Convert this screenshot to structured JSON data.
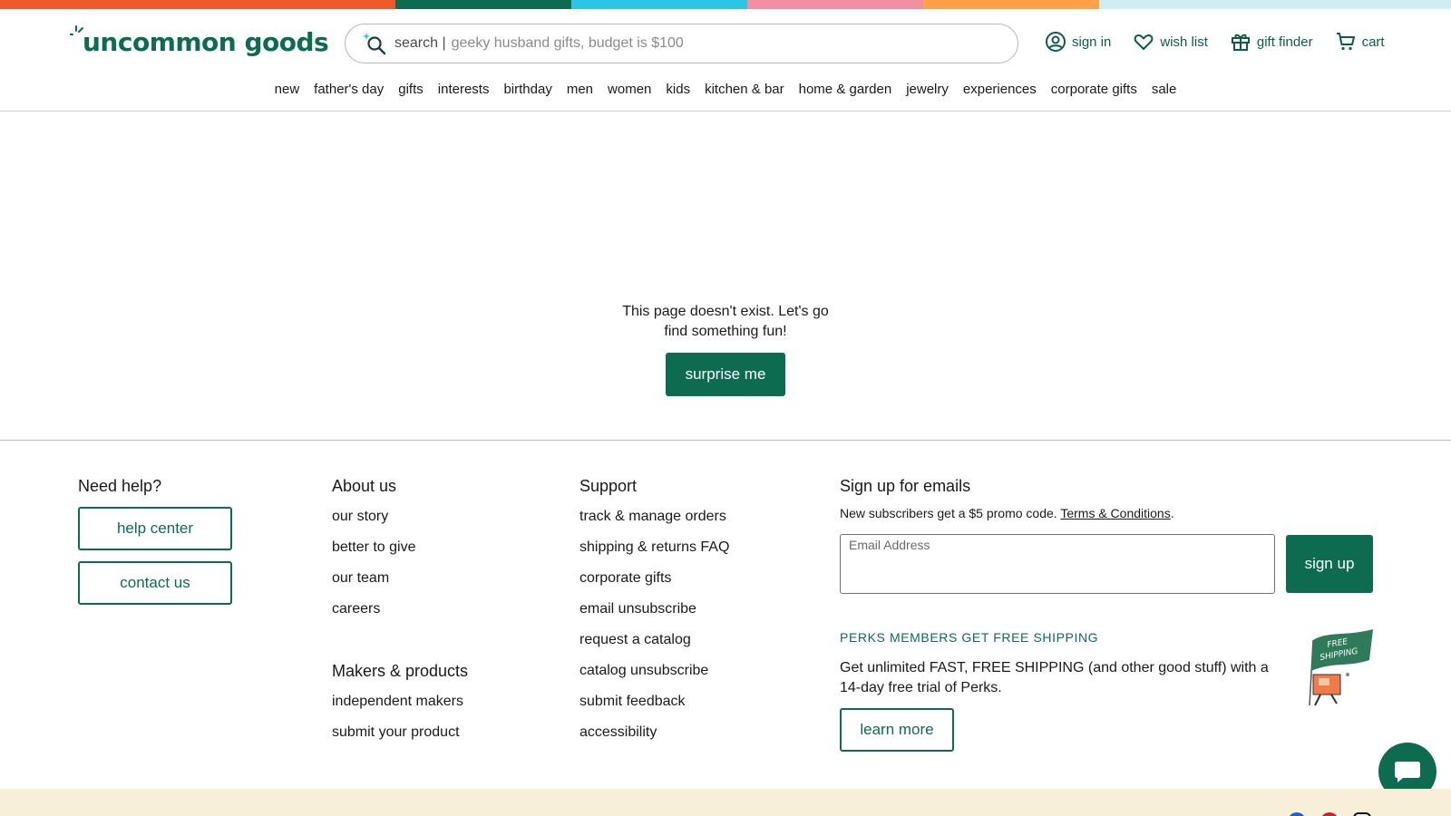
{
  "stripe_colors": [
    "#ef5a2a",
    "#0d6b4f",
    "#2ec4e6",
    "#f28fa0",
    "#ffa04a",
    "#cfeef3"
  ],
  "brand": {
    "logo_text": "uncommon goods",
    "accent": "#0d6b4f"
  },
  "search": {
    "label": "search |",
    "placeholder": "geeky husband gifts, budget is $100",
    "icon": "sparkle-search-icon"
  },
  "header_actions": [
    {
      "label": "sign in",
      "icon": "user-circle-icon"
    },
    {
      "label": "wish list",
      "icon": "heart-icon"
    },
    {
      "label": "gift finder",
      "icon": "gift-icon"
    },
    {
      "label": "cart",
      "icon": "cart-icon"
    }
  ],
  "nav": [
    "new",
    "father's day",
    "gifts",
    "interests",
    "birthday",
    "men",
    "women",
    "kids",
    "kitchen & bar",
    "home & garden",
    "jewelry",
    "experiences",
    "corporate gifts",
    "sale"
  ],
  "main": {
    "message_line1": "This page doesn't exist. Let's go",
    "message_line2": "find something fun!",
    "button": "surprise me"
  },
  "footer": {
    "help": {
      "title": "Need help?",
      "buttons": [
        "help center",
        "contact us"
      ]
    },
    "about": {
      "title": "About us",
      "links": [
        "our story",
        "better to give",
        "our team",
        "careers"
      ]
    },
    "makers": {
      "title": "Makers & products",
      "links": [
        "independent makers",
        "submit your product"
      ]
    },
    "support": {
      "title": "Support",
      "links": [
        "track & manage orders",
        "shipping & returns FAQ",
        "corporate gifts",
        "email unsubscribe",
        "request a catalog",
        "catalog unsubscribe",
        "submit feedback",
        "accessibility"
      ]
    },
    "emails": {
      "title": "Sign up for emails",
      "subtext": "New subscribers get a $5 promo code.",
      "terms": "Terms & Conditions",
      "period": ".",
      "field_label": "Email Address",
      "button": "sign up"
    },
    "perks": {
      "heading": "PERKS MEMBERS GET FREE SHIPPING",
      "body": "Get unlimited FAST, FREE SHIPPING (and other good stuff) with a 14-day free trial of Perks.",
      "button": "learn more",
      "art_text": "FREE SHIPPING"
    }
  }
}
